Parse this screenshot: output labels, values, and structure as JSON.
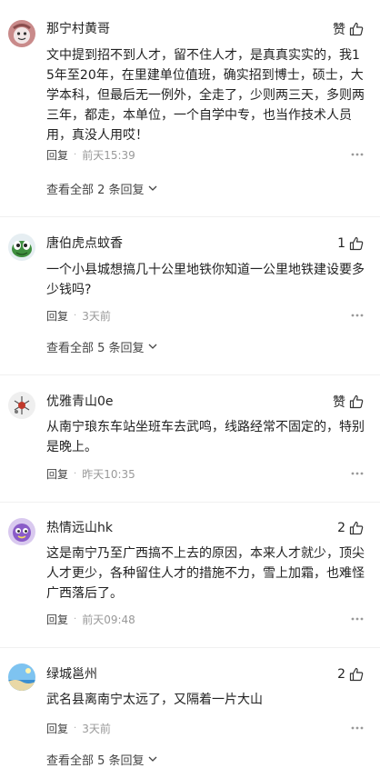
{
  "comments": [
    {
      "username": "那宁村黄哥",
      "like": "赞",
      "text": "文中提到招不到人才，留不住人才，是真真实实的，我15年至20年，在里建单位值班，确实招到博士，硕士，大学本科，但最后无一例外，全走了，少则两三天，多则两三年，都走，本单位，一个自学中专，也当作技术人员用，真没人用哎！",
      "reply": "回复",
      "time": "前天15:39",
      "view_all": "查看全部 2 条回复"
    },
    {
      "username": "唐伯虎点蚊香",
      "like": "1",
      "text": "一个小县城想搞几十公里地铁你知道一公里地铁建设要多少钱吗?",
      "reply": "回复",
      "time": "3天前",
      "view_all": "查看全部 5 条回复"
    },
    {
      "username": "优雅青山0e",
      "like": "赞",
      "text": "从南宁琅东车站坐班车去武鸣，线路经常不固定的，特别是晚上。",
      "reply": "回复",
      "time": "昨天10:35"
    },
    {
      "username": "热情远山hk",
      "like": "2",
      "text": "这是南宁乃至广西搞不上去的原因，本来人才就少，顶尖人才更少，各种留住人才的措施不力，雪上加霜，也难怪广西落后了。",
      "reply": "回复",
      "time": "前天09:48"
    },
    {
      "username": "绿城邕州",
      "like": "2",
      "text": "武名县离南宁太远了，又隔着一片大山",
      "reply": "回复",
      "time": "3天前",
      "view_all": "查看全部 5 条回复"
    }
  ],
  "icons": {
    "like": "thumbs-up-icon",
    "more": "more-horizontal-icon",
    "expand": "chevron-down-icon"
  }
}
